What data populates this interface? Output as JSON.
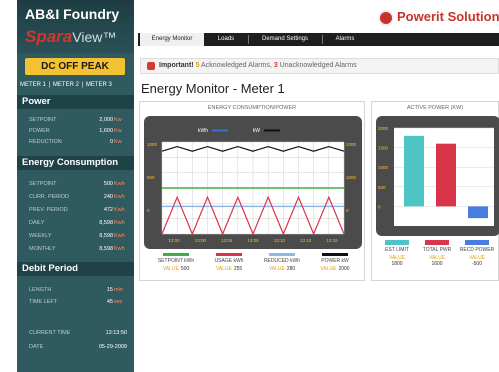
{
  "brand": {
    "company": "AB&I Foundry",
    "product": "Spara",
    "product_suffix": "View",
    "trademark": "™"
  },
  "logo": {
    "text": "Powerit Solution"
  },
  "peak_button": {
    "label": "DC OFF PEAK"
  },
  "meter_tabs": [
    "METER 1",
    "METER 2",
    "METER 3"
  ],
  "power": {
    "title": "Power",
    "rows": [
      {
        "label": "Setpoint",
        "value": "2,000",
        "unit": "Kw"
      },
      {
        "label": "Power",
        "value": "1,600",
        "unit": "Kw"
      },
      {
        "label": "Reduction",
        "value": "0",
        "unit": "Kw"
      }
    ]
  },
  "energy": {
    "title": "Energy Consumption",
    "rows": [
      {
        "label": "Setpoint",
        "value": "500",
        "unit": "Kwh"
      },
      {
        "label": "Curr. Period",
        "value": "240",
        "unit": "Kwh"
      },
      {
        "label": "Prev. Period",
        "value": "472",
        "unit": "Kwh"
      },
      {
        "label": "Daily",
        "value": "8,598",
        "unit": "Kwh"
      },
      {
        "label": "Weekly",
        "value": "8,598",
        "unit": "Kwh"
      },
      {
        "label": "Monthly",
        "value": "8,598",
        "unit": "Kwh"
      }
    ]
  },
  "debit": {
    "title": "Debit Period",
    "rows": [
      {
        "label": "Length",
        "value": "15",
        "unit": "min"
      },
      {
        "label": "Time Left",
        "value": "45",
        "unit": "sec"
      }
    ],
    "meta": [
      {
        "label": "Current Time",
        "value": "13:13:50"
      },
      {
        "label": "Date",
        "value": "05-29-2009"
      }
    ]
  },
  "tabs": [
    {
      "label": "Energy Monitor",
      "active": true
    },
    {
      "label": "Loads",
      "active": false
    },
    {
      "label": "Demand Settings",
      "active": false
    },
    {
      "label": "Alarms",
      "active": false
    }
  ],
  "alert": {
    "prefix": "Important!",
    "ack_count": "5",
    "ack_text": "Acknowledged Alarms,",
    "unack_count": "3",
    "unack_text": "Unacknowledged Alarms"
  },
  "page_title": "Energy Monitor - Meter 1",
  "colors": {
    "setpoint": "#3cb043",
    "usage": "#d8354a",
    "reduced": "#8fb8e8",
    "power": "#111111",
    "est_limit": "#4fc4c4",
    "total_pwr": "#d8354a",
    "recd_power": "#4a7de0"
  },
  "energy_panel": {
    "title": "Energy Consumption/Power",
    "chart_data": {
      "type": "line",
      "title": "Energy Consumption/Power",
      "top_markers": [
        {
          "label": "kWh",
          "color": "#3a6fd8"
        },
        {
          "label": "kW",
          "color": "#111111"
        }
      ],
      "y_left_ticks": [
        "1000",
        "500",
        "0"
      ],
      "y_right_ticks": [
        "2000",
        "1000",
        "0"
      ],
      "x_ticks": [
        "13:00",
        "13:00",
        "13:05",
        "13:05",
        "13:10",
        "13:10",
        "13:15"
      ],
      "legend": [
        {
          "name": "SETPOINT kWh",
          "value_label": "VALUE",
          "value": "500"
        },
        {
          "name": "USAGE kWh",
          "value_label": "VALUE",
          "value": "255"
        },
        {
          "name": "REDUCED kWh",
          "value_label": "VALUE",
          "value": "280"
        },
        {
          "name": "POWER kW",
          "value_label": "VALUE",
          "value": "2000"
        }
      ],
      "series": [
        {
          "name": "SETPOINT kWh",
          "values": [
            500,
            500,
            500,
            500,
            500,
            500,
            500,
            500,
            500,
            500,
            500,
            500,
            500
          ]
        },
        {
          "name": "USAGE kWh",
          "values": [
            0,
            400,
            0,
            400,
            0,
            400,
            0,
            400,
            0,
            400,
            0,
            400,
            0
          ]
        },
        {
          "name": "REDUCED kWh",
          "values": [
            300,
            300,
            300,
            300,
            300,
            300,
            300,
            300,
            300,
            300,
            300,
            300,
            300
          ]
        },
        {
          "name": "POWER kW",
          "values": [
            1800,
            1900,
            1800,
            1900,
            1800,
            1900,
            1800,
            1900,
            1800,
            1900,
            1800,
            1900,
            1800
          ]
        }
      ]
    }
  },
  "power_panel": {
    "title": "Active Power (kW)",
    "chart_data": {
      "type": "bar",
      "title": "Active Power (kW)",
      "categories": [
        "EST LIMIT",
        "TOTAL PWR",
        "RECD POWER"
      ],
      "values": [
        1800,
        1600,
        -300
      ],
      "ylim": [
        -500,
        2000
      ],
      "y_ticks": [
        "2000",
        "1500",
        "1000",
        "500",
        "0"
      ],
      "value_label": "VALUE",
      "value_texts": [
        "1800",
        "1600",
        "-500"
      ]
    }
  }
}
